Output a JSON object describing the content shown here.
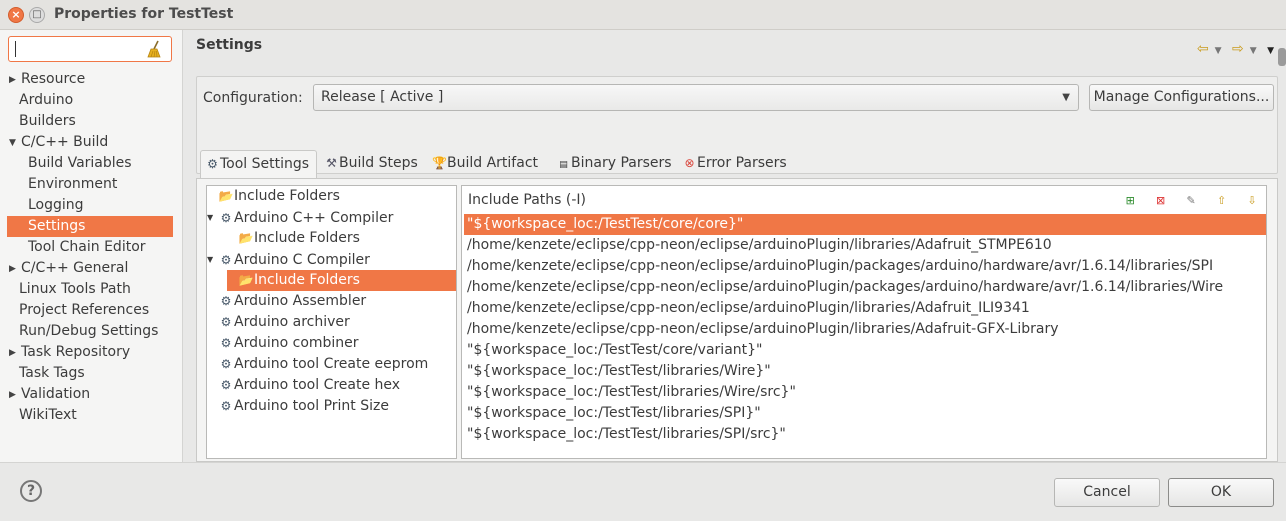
{
  "window": {
    "title": "Properties for TestTest",
    "close_glyph": "×",
    "max_glyph": "□"
  },
  "nav": {
    "filter_value": "",
    "items": [
      {
        "label": "Resource",
        "expandable": true
      },
      {
        "label": "Arduino",
        "expandable": false
      },
      {
        "label": "Builders",
        "expandable": false
      },
      {
        "label": "C/C++ Build",
        "expandable": true,
        "expanded": true
      },
      {
        "label": "Build Variables",
        "child": true
      },
      {
        "label": "Environment",
        "child": true
      },
      {
        "label": "Logging",
        "child": true
      },
      {
        "label": "Settings",
        "child": true,
        "selected": true
      },
      {
        "label": "Tool Chain Editor",
        "child": true
      },
      {
        "label": "C/C++ General",
        "expandable": true
      },
      {
        "label": "Linux Tools Path"
      },
      {
        "label": "Project References"
      },
      {
        "label": "Run/Debug Settings"
      },
      {
        "label": "Task Repository",
        "expandable": true
      },
      {
        "label": "Task Tags"
      },
      {
        "label": "Validation",
        "expandable": true
      },
      {
        "label": "WikiText"
      }
    ]
  },
  "page": {
    "title": "Settings",
    "configuration_label": "Configuration:",
    "configuration_value": "Release  [ Active ]",
    "manage_button": "Manage Configurations..."
  },
  "tabs": [
    {
      "label": "Tool Settings",
      "icon": "tool-settings-icon",
      "active": true
    },
    {
      "label": "Build Steps",
      "icon": "build-steps-icon"
    },
    {
      "label": "Build Artifact",
      "icon": "build-artifact-icon"
    },
    {
      "label": "Binary Parsers",
      "icon": "binary-parsers-icon"
    },
    {
      "label": "Error Parsers",
      "icon": "error-parsers-icon"
    }
  ],
  "tool_tree": [
    {
      "label": "Include Folders",
      "type": "folder",
      "level": 0
    },
    {
      "label": "Arduino C++ Compiler",
      "type": "gear",
      "level": 0,
      "expanded": true
    },
    {
      "label": "Include Folders",
      "type": "folder",
      "level": 1
    },
    {
      "label": "Arduino C Compiler",
      "type": "gear",
      "level": 0,
      "expanded": true
    },
    {
      "label": "Include Folders",
      "type": "folder",
      "level": 1,
      "selected": true
    },
    {
      "label": "Arduino Assembler",
      "type": "gear",
      "level": 0
    },
    {
      "label": "Arduino archiver",
      "type": "gear",
      "level": 0
    },
    {
      "label": "Arduino combiner",
      "type": "gear",
      "level": 0
    },
    {
      "label": "Arduino tool Create eeprom",
      "type": "gear",
      "level": 0
    },
    {
      "label": "Arduino tool Create hex",
      "type": "gear",
      "level": 0
    },
    {
      "label": "Arduino tool Print Size",
      "type": "gear",
      "level": 0
    }
  ],
  "include_paths": {
    "header": "Include Paths (-I)",
    "rows": [
      "\"${workspace_loc:/TestTest/core/core}\"",
      "/home/kenzete/eclipse/cpp-neon/eclipse/arduinoPlugin/libraries/Adafruit_STMPE610",
      "/home/kenzete/eclipse/cpp-neon/eclipse/arduinoPlugin/packages/arduino/hardware/avr/1.6.14/libraries/SPI",
      "/home/kenzete/eclipse/cpp-neon/eclipse/arduinoPlugin/packages/arduino/hardware/avr/1.6.14/libraries/Wire",
      "/home/kenzete/eclipse/cpp-neon/eclipse/arduinoPlugin/libraries/Adafruit_ILI9341",
      "/home/kenzete/eclipse/cpp-neon/eclipse/arduinoPlugin/libraries/Adafruit-GFX-Library",
      "\"${workspace_loc:/TestTest/core/variant}\"",
      "\"${workspace_loc:/TestTest/libraries/Wire}\"",
      "\"${workspace_loc:/TestTest/libraries/Wire/src}\"",
      "\"${workspace_loc:/TestTest/libraries/SPI}\"",
      "\"${workspace_loc:/TestTest/libraries/SPI/src}\""
    ],
    "selected_index": 0
  },
  "footer": {
    "help": "?",
    "cancel": "Cancel",
    "ok": "OK"
  },
  "colors": {
    "accent": "#f07746"
  }
}
